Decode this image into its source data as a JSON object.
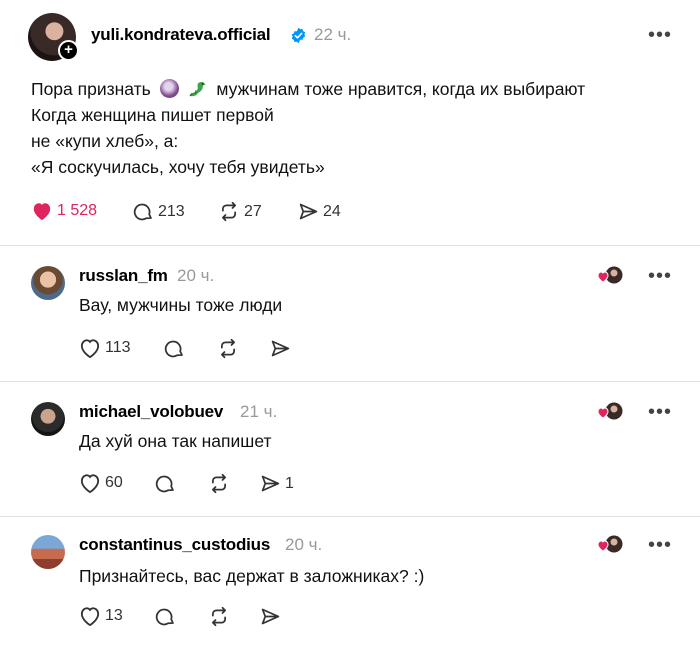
{
  "post": {
    "username": "yuli.kondrateva.official",
    "time": "22 ч.",
    "lines": [
      "Пора признать",
      "мужчинам тоже нравится, когда их выбирают",
      "Когда женщина пишет первой",
      "не «купи хлеб», а:",
      "«Я соскучилась, хочу тебя увидеть»"
    ],
    "stats": {
      "likes": "1 528",
      "comments": "213",
      "reposts": "27",
      "shares": "24"
    }
  },
  "comments": [
    {
      "username": "russlan_fm",
      "time": "20 ч.",
      "text": "Вау, мужчины тоже люди",
      "likes": "113",
      "replies": "",
      "reposts": "",
      "shares": ""
    },
    {
      "username": "michael_volobuev",
      "time": "21 ч.",
      "text": "Да хуй она так напишет",
      "likes": "60",
      "replies": "",
      "reposts": "",
      "shares": "1"
    },
    {
      "username": "constantinus_custodius",
      "time": "20 ч.",
      "text": "Признайтесь, вас держат в заложниках? :)",
      "likes": "13",
      "replies": "",
      "reposts": "",
      "shares": ""
    }
  ],
  "colors": {
    "like_red": "#e0245e",
    "verified_blue": "#0095f6",
    "muted": "#999999"
  },
  "icons": [
    "plus-icon",
    "verified-icon",
    "more-icon",
    "heart-icon",
    "comment-icon",
    "repost-icon",
    "share-icon",
    "crystal-ball-emoji",
    "dragon-emoji",
    "liked-by-author-icon"
  ]
}
